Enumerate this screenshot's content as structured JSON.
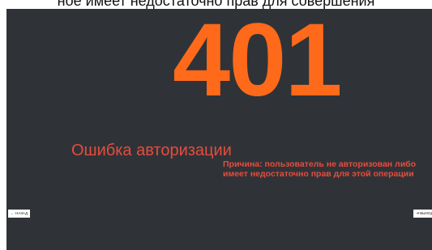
{
  "page": {
    "top_text": "ное имеет недостаточно прав для совершения"
  },
  "error": {
    "code": "401",
    "title": "Ошибка авторизации",
    "reason_line1": "Причина: пользователь не авторизован либо",
    "reason_line2": "имеет недостаточно прав для этой операции"
  },
  "buttons": {
    "back_label": "НАЗАД",
    "back_icon": "arrow-left-icon",
    "exit_label": "ВЫХОД",
    "exit_icon": "exit-icon"
  },
  "colors": {
    "background": "#2f3338",
    "code": "#ff6a1a",
    "error_text": "#e74c3c"
  }
}
